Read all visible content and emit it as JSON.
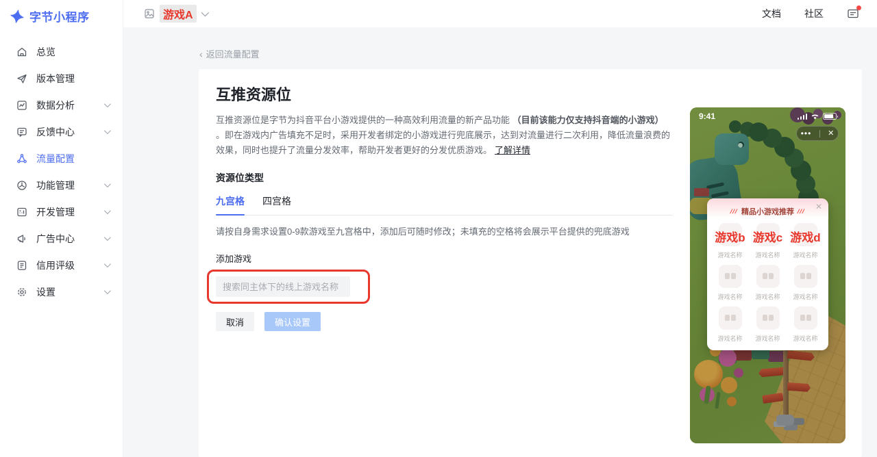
{
  "colors": {
    "accent_blue": "#4e6ef2",
    "annotation_red": "#e8372c",
    "modal_title_red": "#a3453a",
    "badge_red": "#f54a45"
  },
  "app": {
    "logo_text": "字节小程序"
  },
  "header": {
    "game_name": "游戏A",
    "docs_label": "文档",
    "community_label": "社区"
  },
  "sidebar": {
    "items": [
      {
        "label": "总览",
        "icon": "home-icon"
      },
      {
        "label": "版本管理",
        "icon": "version-icon"
      },
      {
        "label": "数据分析",
        "icon": "analytics-icon"
      },
      {
        "label": "反馈中心",
        "icon": "feedback-icon"
      },
      {
        "label": "流量配置",
        "icon": "traffic-icon",
        "active": true
      },
      {
        "label": "功能管理",
        "icon": "feature-icon"
      },
      {
        "label": "开发管理",
        "icon": "develop-icon"
      },
      {
        "label": "广告中心",
        "icon": "ads-icon"
      },
      {
        "label": "信用评级",
        "icon": "credit-icon"
      },
      {
        "label": "设置",
        "icon": "settings-icon"
      }
    ]
  },
  "main": {
    "back_arrow": "‹",
    "back_link": "返回流量配置",
    "title": "互推资源位",
    "desc_part1": "互推资源位是字节为抖音平台小游戏提供的一种高效利用流量的新产品功能 ",
    "desc_bold": "（目前该能力仅支持抖音端的小游戏）",
    "desc_part2": " 。即在游戏内广告填充不足时，采用开发者绑定的小游戏进行兜底展示，达到对流量进行二次利用，降低流量浪费的效果，同时也提升了流量分发效率，帮助开发者更好的分发优质游戏。",
    "learn_more": "了解详情",
    "section_title": "资源位类型",
    "tabs": [
      {
        "label": "九宫格",
        "active": true
      },
      {
        "label": "四宫格",
        "active": false
      }
    ],
    "helper_text": "请按自身需求设置0-9款游戏至九宫格中，添加后可随时修改；未填充的空格将会展示平台提供的兜底游戏",
    "add_game_label": "添加游戏",
    "search_placeholder": "搜索同主体下的线上游戏名称",
    "cancel_label": "取消",
    "confirm_label": "确认设置"
  },
  "phone": {
    "status_time": "9:41",
    "capsule_more": "•••",
    "capsule_close": "✕",
    "modal": {
      "title": "精品小游戏推荐",
      "title_deco": "///",
      "close": "✕",
      "grid": [
        {
          "name": "游戏b",
          "caption": "游戏名称"
        },
        {
          "name": "游戏c",
          "caption": "游戏名称"
        },
        {
          "name": "游戏d",
          "caption": "游戏名称"
        },
        {
          "caption": "游戏名称"
        },
        {
          "caption": "游戏名称"
        },
        {
          "caption": "游戏名称"
        },
        {
          "caption": "游戏名称"
        },
        {
          "caption": "游戏名称"
        },
        {
          "caption": "游戏名称"
        }
      ]
    }
  }
}
